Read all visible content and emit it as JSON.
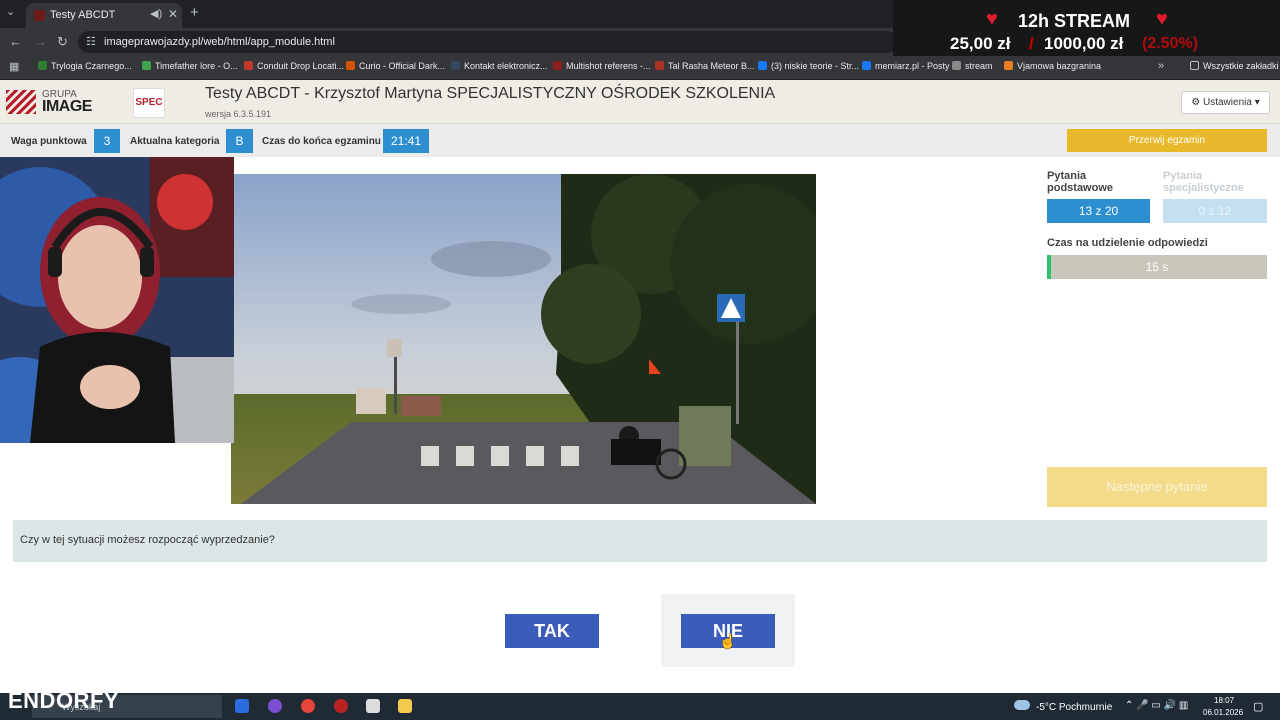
{
  "browser": {
    "tab_title": "Testy ABCDT",
    "url": "imageprawojazdy.pl/web/html/app_module.html",
    "bookmarks": [
      {
        "label": "Trylogia Czarnego...",
        "color": "#2f7d32"
      },
      {
        "label": "Timefather lore - O...",
        "color": "#3fa34d"
      },
      {
        "label": "Conduit Drop Locati...",
        "color": "#c0392b"
      },
      {
        "label": "Curio - Official Dark...",
        "color": "#d35400"
      },
      {
        "label": "Kontakt elektronicz...",
        "color": "#34495e"
      },
      {
        "label": "Multishot referens -...",
        "color": "#8e1e1e"
      },
      {
        "label": "Tal Rasha Meteor B...",
        "color": "#a93226"
      },
      {
        "label": "(3) niskie teorie - Str...",
        "color": "#1877f2"
      },
      {
        "label": "memiarz.pl - Posty",
        "color": "#1877f2"
      },
      {
        "label": "stream",
        "color": "#888888"
      },
      {
        "label": "Vjamowa bazgranina",
        "color": "#e67e22"
      }
    ],
    "all_bookmarks": "Wszystkie zakładki"
  },
  "overlay": {
    "title": "12h STREAM",
    "amount": "25,00 zł",
    "slash": "/",
    "goal": "1000,00 zł",
    "percent": "(2.50%)"
  },
  "app": {
    "logo_top": "GRUPA",
    "logo_bottom": "IMAGE",
    "logo_spec": "SPEC",
    "title": "Testy ABCDT - Krzysztof Martyna SPECJALISTYCZNY OŚRODEK SZKOLENIA",
    "version": "wersja 6.3.5.191",
    "settings": "Ustawienia"
  },
  "status": {
    "weight_label": "Waga punktowa",
    "weight_value": "3",
    "category_label": "Aktualna kategoria",
    "category_value": "B",
    "time_label": "Czas do końca egzaminu",
    "time_value": "21:41",
    "stop_button": "Przerwij egzamin"
  },
  "side": {
    "basic_label_1": "Pytania",
    "basic_label_2": "podstawowe",
    "special_label_1": "Pytania",
    "special_label_2": "specjalistyczne",
    "basic_count": "13 z 20",
    "special_count": "0 z 12",
    "answer_time_label": "Czas na udzielenie odpowiedzi",
    "answer_time": "15 s",
    "next_button": "Następne pytanie"
  },
  "question": {
    "text": "Czy w tej sytuacji możesz rozpocząć wyprzedzanie?",
    "yes": "TAK",
    "no": "NIE"
  },
  "taskbar": {
    "brand": "ENDORFY",
    "search_placeholder": "Wyszukaj",
    "weather": "-5°C  Pochmurnie",
    "time": "18:07",
    "date": "06.01.2026"
  }
}
